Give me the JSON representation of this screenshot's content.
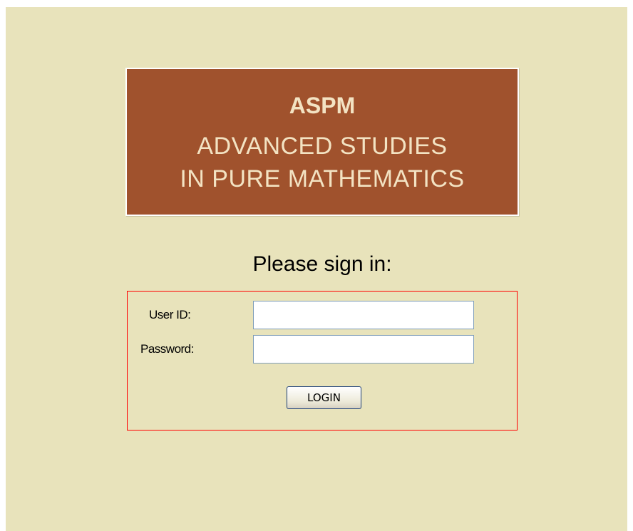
{
  "banner": {
    "abbreviation": "ASPM",
    "line1": "ADVANCED STUDIES",
    "line2": "IN PURE MATHEMATICS"
  },
  "signin": {
    "heading": "Please sign in:"
  },
  "form": {
    "userid_label": "User ID:",
    "userid_value": "",
    "password_label": "Password:",
    "password_value": "",
    "login_label": "LOGIN"
  },
  "colors": {
    "page_background": "#e8e3bb",
    "banner_background": "#a0522d",
    "banner_text": "#f3e3c3",
    "form_border": "#ff0000"
  }
}
